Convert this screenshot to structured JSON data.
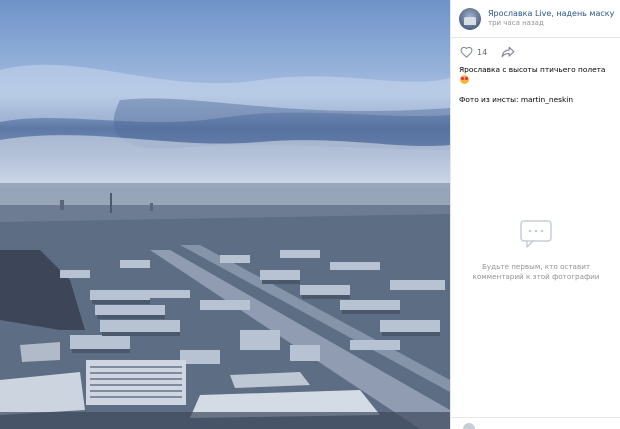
{
  "post": {
    "group_name": "Ярославка Live, надень маску",
    "time": "три часа назад",
    "likes": "14",
    "caption": "Ярославка с высоты птичьего полета",
    "source": "Фото из инсты: martin_neskin"
  },
  "comments": {
    "empty_text": "Будьте первым, кто оставит комментарий к этой фотографии"
  },
  "icons": {
    "like": "heart-icon",
    "share": "share-arrow-icon",
    "comments_empty": "comment-bubble-icon",
    "caption_emoji": "heart-eyes-emoji"
  }
}
